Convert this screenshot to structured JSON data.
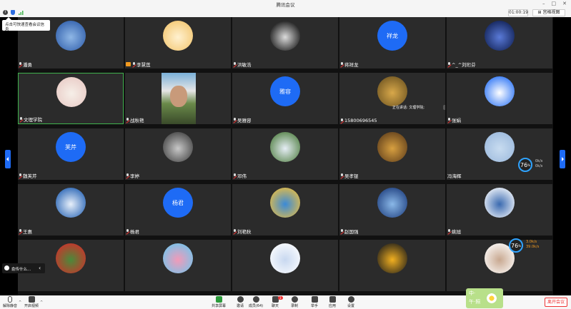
{
  "window": {
    "title": "腾讯会议",
    "controls": [
      "–",
      "□",
      "✕"
    ]
  },
  "header": {
    "timer": "01:00:19",
    "view_label": "⊞ 宫格视图",
    "tooltip": "点击可快速查看会议信息"
  },
  "participants": [
    {
      "name": "潘勇",
      "avatar_type": "photo",
      "palette": [
        "#2b5aa8",
        "#8fb7e6"
      ]
    },
    {
      "name": "李慧莲",
      "avatar_type": "photo",
      "host": true,
      "palette": [
        "#f2c46b",
        "#fff1d0"
      ]
    },
    {
      "name": "洪敏浩",
      "avatar_type": "photo",
      "palette": [
        "#000000",
        "#dcdcdc"
      ]
    },
    {
      "name": "蒋祥龙",
      "avatar_type": "text",
      "avatar_text": "祥龙"
    },
    {
      "name": "^_^刘珩芬",
      "avatar_type": "photo",
      "palette": [
        "#0b1a4a",
        "#5a7ad8"
      ]
    },
    {
      "name": "文理学院",
      "avatar_type": "photo",
      "active": true,
      "palette": [
        "#e8c9c4",
        "#f6efe8"
      ]
    },
    {
      "name": "战秋艳",
      "avatar_type": "video"
    },
    {
      "name": "吴雅容",
      "avatar_type": "text",
      "avatar_text": "雅容"
    },
    {
      "name": "15800696545",
      "avatar_type": "photo",
      "speaking": true,
      "speaking_text": "正在讲话: 文理学院;",
      "palette": [
        "#6b5220",
        "#d8a84a"
      ]
    },
    {
      "name": "张娟",
      "avatar_type": "photo",
      "palette": [
        "#1e6bf5",
        "#ffffff"
      ]
    },
    {
      "name": "魏芙芹",
      "avatar_type": "text",
      "avatar_text": "芙芹"
    },
    {
      "name": "李婷",
      "avatar_type": "photo",
      "palette": [
        "#3a3a3a",
        "#c8c8c8"
      ]
    },
    {
      "name": "邓伟",
      "avatar_type": "photo",
      "palette": [
        "#4a7a3a",
        "#e6eef6"
      ]
    },
    {
      "name": "吴孝锟",
      "avatar_type": "photo",
      "palette": [
        "#5a3a1a",
        "#d8a040"
      ]
    },
    {
      "name": "冯海辉",
      "avatar_type": "photo",
      "no_mic": true,
      "palette": [
        "#9ab8dc",
        "#c8dcf0"
      ]
    },
    {
      "name": "王惠",
      "avatar_type": "photo",
      "palette": [
        "#1a5ab0",
        "#e8f0fa"
      ]
    },
    {
      "name": "杨君",
      "avatar_type": "text",
      "avatar_text": "杨君"
    },
    {
      "name": "刘艳秋",
      "avatar_type": "photo",
      "palette": [
        "#f2c03a",
        "#3a8ad8"
      ]
    },
    {
      "name": "赵国强",
      "avatar_type": "photo",
      "palette": [
        "#1a3a7a",
        "#8ab8e8"
      ]
    },
    {
      "name": "姚旭",
      "avatar_type": "photo",
      "palette": [
        "#ffffff",
        "#3a6ab0"
      ]
    },
    {
      "name": "",
      "avatar_type": "photo",
      "palette": [
        "#d82a2a",
        "#4a8a3a"
      ]
    },
    {
      "name": "",
      "avatar_type": "photo",
      "palette": [
        "#6ac8f0",
        "#f29ab8"
      ]
    },
    {
      "name": "",
      "avatar_type": "photo",
      "palette": [
        "#ffffff",
        "#c8d8f0"
      ]
    },
    {
      "name": "",
      "avatar_type": "photo",
      "palette": [
        "#1a1a1a",
        "#f2b020"
      ]
    },
    {
      "name": "",
      "avatar_type": "photo",
      "palette": [
        "#ffffff",
        "#c8a890"
      ]
    }
  ],
  "speaker_bar": {
    "text": "俞传什么...",
    "chevron": "‹"
  },
  "network": [
    {
      "value": "76",
      "unit": "%",
      "up": "0",
      "up_unit": "k/s",
      "down": "0",
      "down_unit": "k/s"
    },
    {
      "value": "76",
      "unit": "%",
      "up": "3.0",
      "up_unit": "k/s",
      "down": "39.0",
      "down_unit": "k/s"
    }
  ],
  "toolbar": {
    "mute_label": "解除静音",
    "video_label": "开启视频",
    "share_label": "共享屏幕",
    "invite_label": "邀请",
    "members_label": "成员(64)",
    "chat_label": "聊天",
    "record_label": "录制",
    "raise_label": "举手",
    "apps_label": "应用",
    "settings_label": "设置",
    "leave_label": "离开会议",
    "chat_badge": "1"
  },
  "sticker": {
    "line1": "中·",
    "line2": "午·照"
  },
  "colors": {
    "accent": "#1e6bf5",
    "active_border": "#3fb24c",
    "leave": "#e33333",
    "tile_bg": "#2b2b2b"
  }
}
